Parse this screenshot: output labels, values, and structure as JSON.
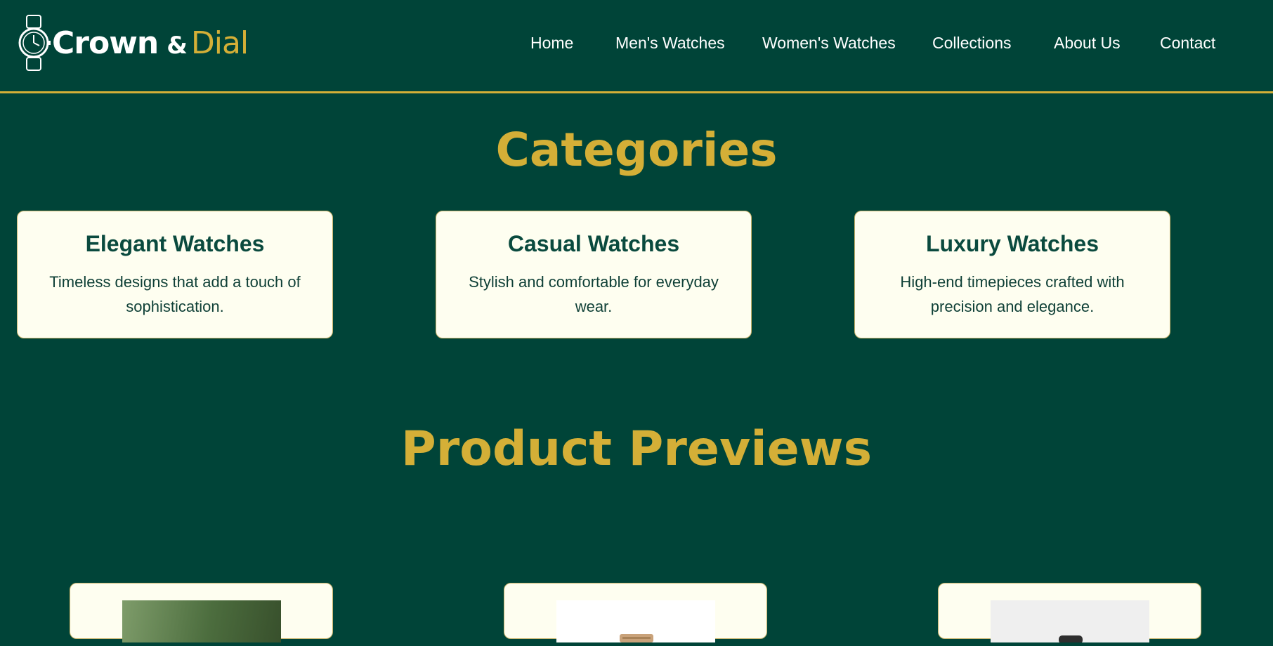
{
  "brand": {
    "name_part1": "Crown",
    "ampersand": "&",
    "name_part2": "Dial",
    "logo_icon": "wristwatch-icon"
  },
  "nav": {
    "items": [
      {
        "label": "Home"
      },
      {
        "label": "Men's Watches"
      },
      {
        "label": "Women's Watches"
      },
      {
        "label": "Collections"
      },
      {
        "label": "About Us"
      },
      {
        "label": "Contact"
      }
    ]
  },
  "categories": {
    "title": "Categories",
    "cards": [
      {
        "title": "Elegant Watches",
        "description": "Timeless designs that add a touch of sophistication."
      },
      {
        "title": "Casual Watches",
        "description": "Stylish and comfortable for everyday wear."
      },
      {
        "title": "Luxury Watches",
        "description": "High-end timepieces crafted with precision and elegance."
      }
    ]
  },
  "product_previews": {
    "title": "Product Previews",
    "items": [
      {
        "image": "green-watch-photo"
      },
      {
        "image": "gold-bracelet-watch-photo"
      },
      {
        "image": "black-watch-photo"
      }
    ]
  },
  "colors": {
    "background": "#004438",
    "accent_gold": "#d4af37",
    "card_background": "#fefef0",
    "text_dark_green": "#0a4a3e"
  }
}
